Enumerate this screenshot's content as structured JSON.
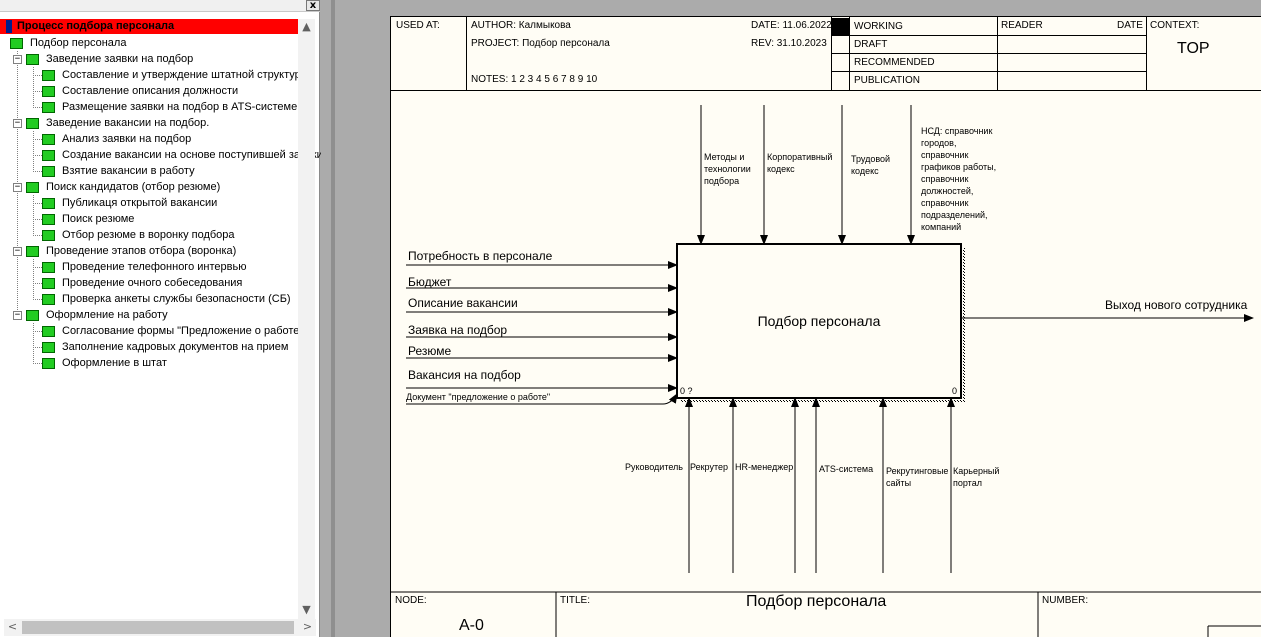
{
  "tree": {
    "root": "Процесс подбора персонала",
    "main": "Подбор персонала",
    "groups": [
      {
        "label": "Заведение заявки на подбор",
        "items": [
          "Составление и утверждение штатной структуры",
          "Составление описания должности",
          "Размещение заявки на подбор в ATS-системе"
        ]
      },
      {
        "label": "Заведение вакансии на подбор.",
        "items": [
          "Анализ заявки на подбор",
          "Создание вакансии на основе поступившей заявки",
          "Взятие вакансии в работу"
        ]
      },
      {
        "label": "Поиск кандидатов (отбор резюме)",
        "items": [
          "Публикаця открытой вакансии",
          "Поиск резюме",
          "Отбор резюме в воронку подбора"
        ]
      },
      {
        "label": "Проведение этапов отбора (воронка)",
        "items": [
          "Проведение телефонного интервью",
          "Проведение очного собеседования",
          "Проверка анкеты службы безопасности (СБ)"
        ]
      },
      {
        "label": "Оформление на работу",
        "items": [
          "Согласование формы \"Предложение о работе\"",
          "Заполнение кадровых документов на прием",
          "Оформление в штат"
        ]
      }
    ],
    "expander_symbol": "−",
    "close_symbol": "x",
    "scroll_up": "▲",
    "scroll_down": "▼",
    "scroll_left": "<",
    "scroll_right": ">"
  },
  "header": {
    "used_at": "USED AT:",
    "author": "AUTHOR:  Калмыкова",
    "project": "PROJECT:  Подбор персонала",
    "notes": "NOTES:  1  2  3  4  5  6  7  8  9  10",
    "date": "DATE:  11.06.2022",
    "rev": "REV:   31.10.2023",
    "status": [
      "WORKING",
      "DRAFT",
      "RECOMMENDED",
      "PUBLICATION"
    ],
    "reader": "READER",
    "date2": "DATE",
    "context": "CONTEXT:",
    "context_value": "TOP"
  },
  "activity": {
    "title": "Подбор персонала",
    "left_code": "0 ?",
    "right_code": "0"
  },
  "inputs": [
    "Потребность в персонале",
    "Бюджет",
    "Описание вакансии",
    "Заявка на подбор",
    "Резюме",
    "Вакансия на подбор",
    "Документ \"предложение о работе\""
  ],
  "controls": [
    [
      "Методы и",
      "технологии",
      "подбора"
    ],
    [
      "Корпоративный",
      "кодекс"
    ],
    [
      "Трудовой",
      "кодекс"
    ],
    [
      "НСД: справочник",
      "городов,",
      "справочник",
      "графиков работы,",
      "справочник",
      "должностей,",
      "справочник",
      "подразделений,",
      "компаний"
    ]
  ],
  "output": "Выход нового сотрудника",
  "mechanisms": [
    [
      "Руководитель"
    ],
    [
      "Рекрутер"
    ],
    [
      "HR-менеджер"
    ],
    [
      "ATS-система"
    ],
    [
      "Рекрутинговые",
      "сайты"
    ],
    [
      "Карьерный",
      "портал"
    ]
  ],
  "footer": {
    "node_label": "NODE:",
    "node_value": "A-0",
    "title_label": "TITLE:",
    "title_value": "Подбор персонала",
    "number_label": "NUMBER:"
  }
}
